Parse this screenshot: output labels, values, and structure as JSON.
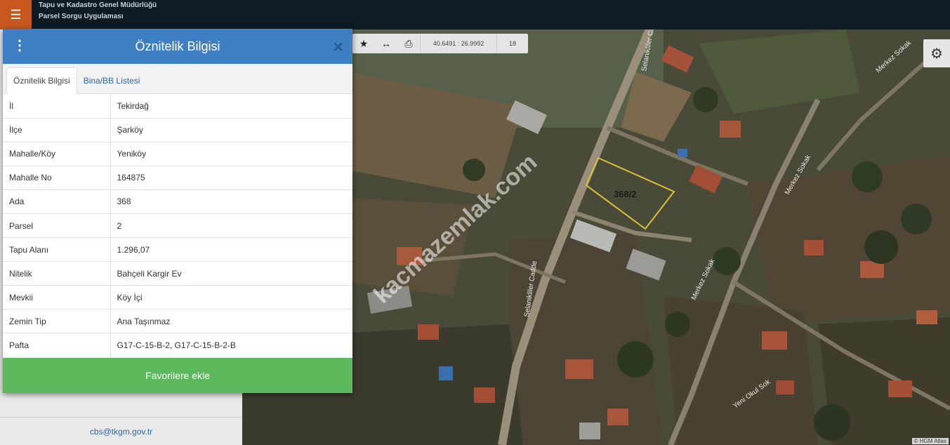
{
  "header": {
    "org_name": "Tapu ve Kadastro Genel Müdürlüğü",
    "app_name": "Parsel Sorgu Uygulaması",
    "menu_icon": "hamburger-icon"
  },
  "map": {
    "coordinates": "40.6491 : 26.9992",
    "zoom": "18",
    "parcel_label": "368/2",
    "watermark": "kacmazemlak.com",
    "street_labels": [
      "Selanikliler Cadde",
      "Selanikliler Cadde",
      "Merkez Sokak",
      "Merkez Sokak",
      "Merkez Sokak",
      "Yeni Okul Sok"
    ],
    "attribution": "© HGM Atlas",
    "toolbar_icons": [
      "star-icon",
      "measure-icon",
      "print-icon"
    ]
  },
  "panel": {
    "title": "Öznitelik Bilgisi",
    "tabs": [
      "Öznitelik Bilgisi",
      "Bina/BB Listesi"
    ],
    "rows": [
      {
        "key": "İl",
        "value": "Tekirdağ"
      },
      {
        "key": "İlçe",
        "value": "Şarköy"
      },
      {
        "key": "Mahalle/Köy",
        "value": "Yeniköy"
      },
      {
        "key": "Mahalle No",
        "value": "164875"
      },
      {
        "key": "Ada",
        "value": "368"
      },
      {
        "key": "Parsel",
        "value": "2"
      },
      {
        "key": "Tapu Alanı",
        "value": "1.296,07"
      },
      {
        "key": "Nitelik",
        "value": "Bahçeli Kargir Ev"
      },
      {
        "key": "Mevkii",
        "value": "Köy İçi"
      },
      {
        "key": "Zemin Tip",
        "value": "Ana Taşınmaz"
      },
      {
        "key": "Pafta",
        "value": "G17-C-15-B-2, G17-C-15-B-2-B"
      }
    ],
    "favorite_button": "Favorilere ekle"
  },
  "sidebar": {
    "contact_email": "cbs@tkgm.gov.tr"
  },
  "colors": {
    "header_bg": "#0e1a24",
    "menu_btn": "#c8571f",
    "panel_header": "#3e7ec2",
    "favorite_btn": "#5cb85c",
    "parcel_outline": "#d8c23a"
  }
}
